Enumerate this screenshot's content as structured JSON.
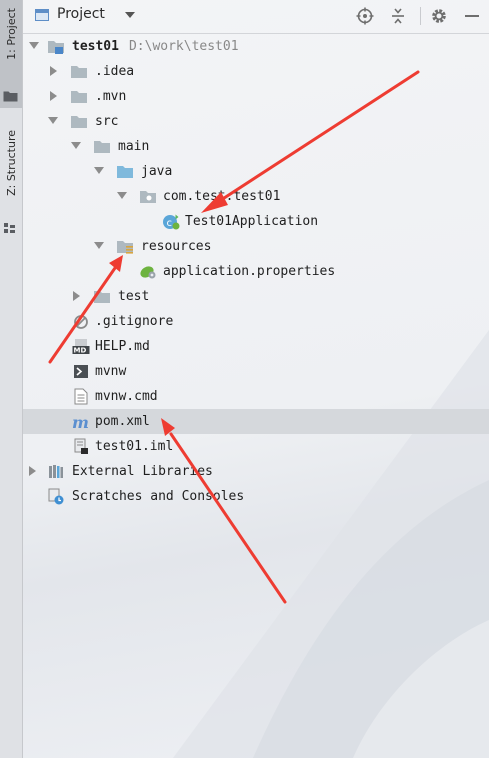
{
  "stripe": {
    "project_tab": "1: Project",
    "structure_tab": "Z: Structure"
  },
  "header": {
    "view_title": "Project",
    "icons": [
      "locate-icon",
      "collapse-all-icon",
      "settings-icon",
      "hide-icon"
    ]
  },
  "tree": {
    "root": {
      "label": "test01",
      "path": "D:\\work\\test01"
    },
    "idea": ".idea",
    "mvn": ".mvn",
    "src": "src",
    "main": "main",
    "java": "java",
    "package": "com.test.test01",
    "app_class": "Test01Application",
    "resources": "resources",
    "props": "application.properties",
    "test": "test",
    "gitignore": ".gitignore",
    "help": "HELP.md",
    "mvnw": "mvnw",
    "mvnw_cmd": "mvnw.cmd",
    "pom": "pom.xml",
    "iml": "test01.iml",
    "external": "External Libraries",
    "scratches": "Scratches and Consoles"
  },
  "colors": {
    "annotation_arrow": "#ee3c32",
    "folder": "#aeb9c0",
    "source_folder": "#7fb9dc"
  }
}
